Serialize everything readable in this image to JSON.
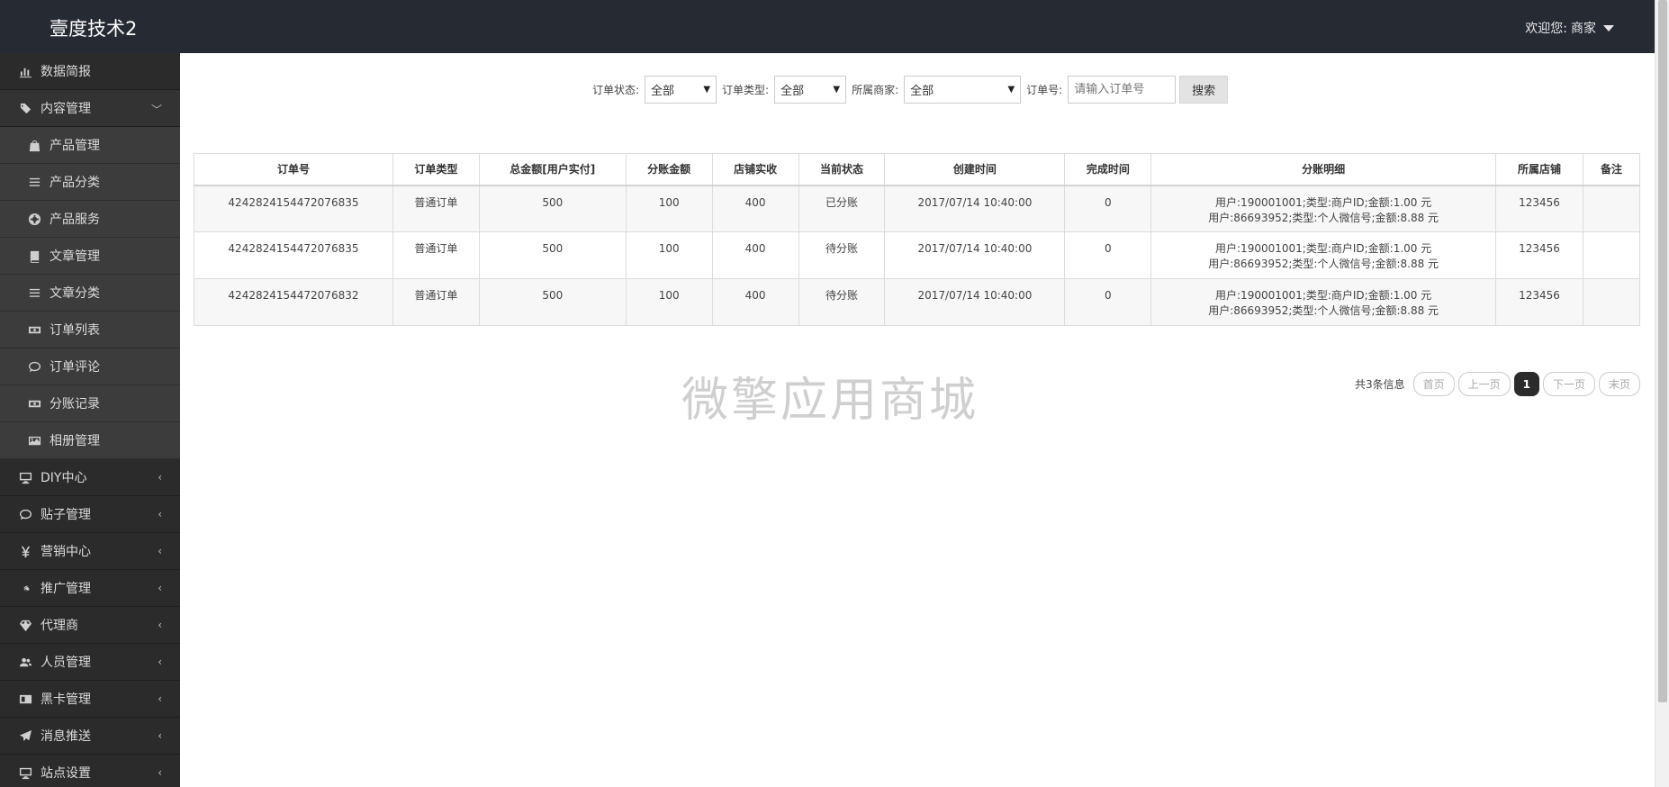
{
  "header": {
    "brand": "壹度技术2",
    "welcome_prefix": "欢迎您:",
    "user": "商家"
  },
  "sidebar": {
    "items": [
      {
        "label": "数据简报",
        "icon": "bar-chart-icon",
        "type": "top",
        "arrow": ""
      },
      {
        "label": "内容管理",
        "icon": "tags-icon",
        "type": "open",
        "arrow": "﹀"
      },
      {
        "label": "产品管理",
        "icon": "shopping-bag-icon",
        "type": "sub",
        "arrow": ""
      },
      {
        "label": "产品分类",
        "icon": "list-icon",
        "type": "sub",
        "arrow": ""
      },
      {
        "label": "产品服务",
        "icon": "support-icon",
        "type": "sub",
        "arrow": ""
      },
      {
        "label": "文章管理",
        "icon": "book-icon",
        "type": "sub",
        "arrow": ""
      },
      {
        "label": "文章分类",
        "icon": "list-icon",
        "type": "sub",
        "arrow": ""
      },
      {
        "label": "订单列表",
        "icon": "money-icon",
        "type": "sub",
        "arrow": ""
      },
      {
        "label": "订单评论",
        "icon": "comment-icon",
        "type": "sub",
        "arrow": ""
      },
      {
        "label": "分账记录",
        "icon": "money-icon",
        "type": "sub",
        "arrow": ""
      },
      {
        "label": "相册管理",
        "icon": "image-icon",
        "type": "sub",
        "arrow": ""
      },
      {
        "label": "DIY中心",
        "icon": "desktop-icon",
        "type": "top",
        "arrow": "‹"
      },
      {
        "label": "贴子管理",
        "icon": "comment-icon",
        "type": "top",
        "arrow": "‹"
      },
      {
        "label": "营销中心",
        "icon": "yen-icon",
        "type": "top",
        "arrow": "‹"
      },
      {
        "label": "推广管理",
        "icon": "share-icon",
        "type": "top",
        "arrow": "‹"
      },
      {
        "label": "代理商",
        "icon": "diamond-icon",
        "type": "top",
        "arrow": "‹"
      },
      {
        "label": "人员管理",
        "icon": "users-icon",
        "type": "top",
        "arrow": "‹"
      },
      {
        "label": "黑卡管理",
        "icon": "id-card-icon",
        "type": "top",
        "arrow": "‹"
      },
      {
        "label": "消息推送",
        "icon": "paper-plane-icon",
        "type": "top",
        "arrow": "‹"
      },
      {
        "label": "站点设置",
        "icon": "desktop-icon",
        "type": "top",
        "arrow": "‹"
      }
    ]
  },
  "filters": {
    "status_label": "订单状态:",
    "status_value": "全部",
    "type_label": "订单类型:",
    "type_value": "全部",
    "merchant_label": "所属商家:",
    "merchant_value": "全部",
    "order_no_label": "订单号:",
    "order_no_placeholder": "请输入订单号",
    "search_button": "搜索"
  },
  "table": {
    "headers": [
      "订单号",
      "订单类型",
      "总金额[用户实付]",
      "分账金额",
      "店铺实收",
      "当前状态",
      "创建时间",
      "完成时间",
      "分账明细",
      "所属店铺",
      "备注"
    ],
    "rows": [
      {
        "order_no": "4242824154472076835",
        "type": "普通订单",
        "total": "500",
        "split": "100",
        "shop_income": "400",
        "status": "已分账",
        "created": "2017/07/14 10:40:00",
        "completed": "0",
        "detail_1": "用户:190001001;类型:商户ID;金额:1.00 元",
        "detail_2": "用户:86693952;类型:个人微信号;金额:8.88 元",
        "shop": "123456",
        "remark": ""
      },
      {
        "order_no": "4242824154472076835",
        "type": "普通订单",
        "total": "500",
        "split": "100",
        "shop_income": "400",
        "status": "待分账",
        "created": "2017/07/14 10:40:00",
        "completed": "0",
        "detail_1": "用户:190001001;类型:商户ID;金额:1.00 元",
        "detail_2": "用户:86693952;类型:个人微信号;金额:8.88 元",
        "shop": "123456",
        "remark": ""
      },
      {
        "order_no": "4242824154472076832",
        "type": "普通订单",
        "total": "500",
        "split": "100",
        "shop_income": "400",
        "status": "待分账",
        "created": "2017/07/14 10:40:00",
        "completed": "0",
        "detail_1": "用户:190001001;类型:商户ID;金额:1.00 元",
        "detail_2": "用户:86693952;类型:个人微信号;金额:8.88 元",
        "shop": "123456",
        "remark": ""
      }
    ]
  },
  "watermark": "微擎应用商城",
  "pager": {
    "info": "共3条信息",
    "first": "首页",
    "prev": "上一页",
    "current": "1",
    "next": "下一页",
    "last": "末页"
  }
}
